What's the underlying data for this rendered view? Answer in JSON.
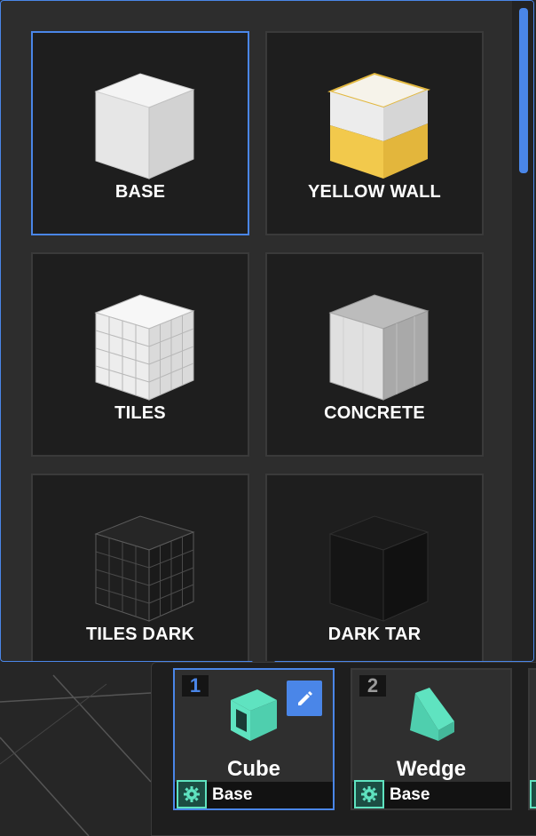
{
  "materials": [
    {
      "label": "BASE"
    },
    {
      "label": "YELLOW WALL"
    },
    {
      "label": "TILES"
    },
    {
      "label": "CONCRETE"
    },
    {
      "label": "TILES DARK"
    },
    {
      "label": "DARK TAR"
    }
  ],
  "shapes": [
    {
      "index": "1",
      "name": "Cube",
      "material": "Base"
    },
    {
      "index": "2",
      "name": "Wedge",
      "material": "Base"
    }
  ],
  "colors": {
    "accent": "#4a86e8",
    "shape_icon": "#5fe3c0",
    "yellow": "#f2c94c"
  },
  "icons": {
    "edit": "pencil-icon",
    "settings": "gear-icon",
    "cube": "cube-icon",
    "wedge": "wedge-icon"
  }
}
